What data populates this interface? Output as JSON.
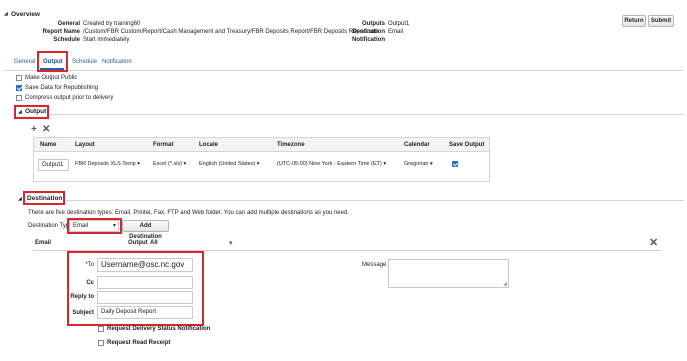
{
  "overview": {
    "title": "Overview",
    "general_label": "General",
    "general_value": "Created by training60",
    "report_name_label": "Report Name",
    "report_name_value": "/Custom/FBR Custom/Report/Cash Management and Treasury/FBR Deposits Report/FBR Deposits Report.xdo",
    "schedule_label": "Schedule",
    "schedule_value": "Start immediately",
    "outputs_label": "Outputs",
    "outputs_value": "Output1",
    "destination_label": "Destination",
    "destination_value": "Email",
    "notification_label": "Notification",
    "notification_value": ""
  },
  "actions": {
    "return_label": "Return",
    "submit_label": "Submit"
  },
  "tabs": [
    {
      "label": "General"
    },
    {
      "label": "Output"
    },
    {
      "label": "Schedule"
    },
    {
      "label": "Notification"
    }
  ],
  "options": {
    "make_public_label": "Make Output Public",
    "save_data_label": "Save Data for Republishing",
    "compress_label": "Compress output prior to delivery"
  },
  "output_section": {
    "title": "Output",
    "columns": [
      "Name",
      "Layout",
      "Format",
      "Locale",
      "Timezone",
      "Calendar",
      "Save Output"
    ],
    "row": {
      "name": "Output1",
      "layout": "FBR Deposits XLS Temp",
      "format": "Excel (*.xls)",
      "locale": "English (United States)",
      "timezone": "(UTC-05:00) New York - Eastern Time (ET)",
      "calendar": "Gregorian"
    }
  },
  "destination_section": {
    "title": "Destination",
    "info": "There are five destination types: Email, Printer, Fax, FTP and Web folder. You can add multiple destinations as you need.",
    "type_label": "Destination Type",
    "type_value": "Email",
    "add_button_label": "Add Destination",
    "email_header": "Email",
    "output_label": "Output",
    "output_value": "All",
    "to_label": "*To",
    "to_value": "Username@osc.nc.gov",
    "cc_label": "Cc",
    "reply_to_label": "Reply to",
    "subject_label": "Subject",
    "subject_value": "Daily Deposit Report",
    "message_label": "Message",
    "delivery_notification_label": "Request Delivery Status Notification",
    "read_receipt_label": "Request Read Receipt"
  }
}
